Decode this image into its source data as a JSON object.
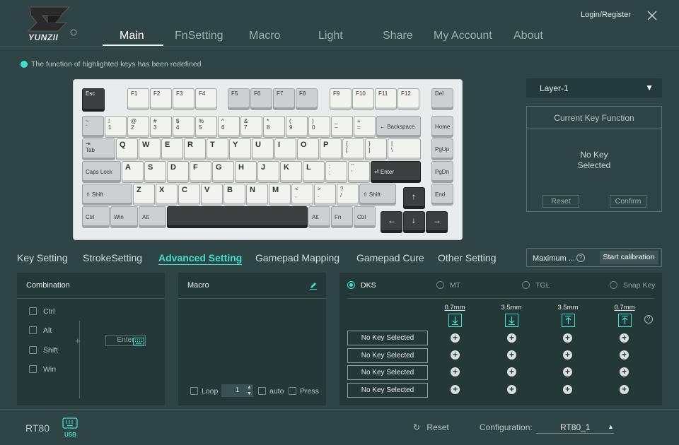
{
  "app": {
    "logo_text": "YUNZII",
    "login": "Login/Register"
  },
  "nav": [
    "Main",
    "FnSetting",
    "Macro",
    "Light",
    "Share",
    "My Account",
    "About"
  ],
  "hint": "The function of highlighted keys has been redefined",
  "keyboard": {
    "row0": [
      "Esc",
      "F1",
      "F2",
      "F3",
      "F4",
      "F5",
      "F6",
      "F7",
      "F8",
      "F9",
      "F10",
      "F11",
      "F12",
      "Del"
    ],
    "row1": [
      "~\n`",
      "!\n1",
      "@\n2",
      "#\n3",
      "$\n4",
      "%\n5",
      "^\n6",
      "&\n7",
      "*\n8",
      "(\n9",
      ")\n0",
      "_\n–",
      "+\n=",
      "← Backspace",
      "Home"
    ],
    "row2": [
      "⇥\nTab",
      "Q",
      "W",
      "E",
      "R",
      "T",
      "Y",
      "U",
      "I",
      "O",
      "P",
      "{\n[",
      "}\n]",
      "|\n\\",
      "PgUp"
    ],
    "row3": [
      "Caps Lock",
      "A",
      "S",
      "D",
      "F",
      "G",
      "H",
      "J",
      "K",
      "L",
      ":\n;",
      "\"\n'",
      "⏎ Enter",
      "PgDn"
    ],
    "row4": [
      "⇧ Shift",
      "Z",
      "X",
      "C",
      "V",
      "B",
      "N",
      "M",
      "<\n,",
      ">\n.",
      "?\n/",
      "⇧ Shift",
      "↑",
      "End"
    ],
    "row5": [
      "Ctrl",
      "Win",
      "Alt",
      "",
      "Alt",
      "Fn",
      "Ctrl",
      "←",
      "↓",
      "→"
    ]
  },
  "layer": {
    "selected": "Layer-1"
  },
  "current_key": {
    "title": "Current Key Function",
    "line1": "No Key",
    "line2": "Selected",
    "reset": "Reset",
    "confirm": "Confirm"
  },
  "tabs": [
    "Key Setting",
    "StrokeSetting",
    "Advanced Setting",
    "Gamepad Mapping",
    "Gamepad Cure",
    "Other Setting"
  ],
  "calibration": {
    "mode": "Maximum ...",
    "button": "Start calibration"
  },
  "combination": {
    "title": "Combination",
    "modifiers": [
      "Ctrl",
      "Alt",
      "Shift",
      "Win"
    ],
    "plus": "+",
    "enter_placeholder": "Enter"
  },
  "macro": {
    "title": "Macro",
    "loop": "Loop",
    "loop_count": "1",
    "auto": "auto",
    "press": "Press"
  },
  "advanced": {
    "options": [
      "DKS",
      "MT",
      "TGL",
      "Snap Key"
    ],
    "selected": "DKS",
    "distances": [
      "0.7mm",
      "3.5mm",
      "3.5mm",
      "0.7mm"
    ],
    "slots": [
      "No Key Selected",
      "No Key Selected",
      "No Key Selected",
      "No Key Selected"
    ]
  },
  "footer": {
    "device": "RT80",
    "usb": "USB",
    "reset": "Reset",
    "config_label": "Configuration:",
    "config_value": "RT80_1"
  },
  "colors": {
    "accent": "#3ee0d0",
    "background": "#2f4444",
    "panel": "#253838"
  },
  "icons": [
    "logo-icon",
    "close-icon",
    "edit-icon",
    "keyboard-icon",
    "help-icon",
    "usb-keyboard-icon",
    "reset-icon",
    "caret-up-icon",
    "arrow-down-icon",
    "arrow-up-icon",
    "plus-icon"
  ]
}
